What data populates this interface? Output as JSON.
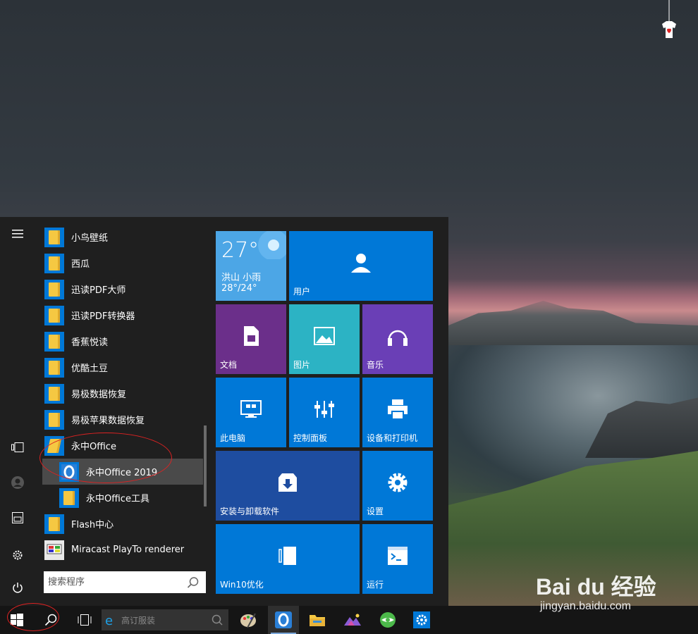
{
  "app_list": [
    {
      "label": "小鸟壁纸",
      "type": "folder"
    },
    {
      "label": "西瓜",
      "type": "folder"
    },
    {
      "label": "迅读PDF大师",
      "type": "folder"
    },
    {
      "label": "迅读PDF转换器",
      "type": "folder"
    },
    {
      "label": "香蕉悦读",
      "type": "folder"
    },
    {
      "label": "优酷土豆",
      "type": "folder"
    },
    {
      "label": "易极数据恢复",
      "type": "folder"
    },
    {
      "label": "易极苹果数据恢复",
      "type": "folder"
    },
    {
      "label": "永中Office",
      "type": "folder-open"
    },
    {
      "label": "永中Office 2019",
      "type": "app"
    },
    {
      "label": "永中Office工具",
      "type": "folder"
    },
    {
      "label": "Flash中心",
      "type": "folder"
    },
    {
      "label": "Miracast PlayTo renderer",
      "type": "app"
    }
  ],
  "search": {
    "placeholder": "搜索程序"
  },
  "tiles": {
    "weather": {
      "temp": "27°",
      "city": "洪山",
      "condition": "小雨",
      "range": "28°/24°"
    },
    "user": "用户",
    "documents": "文档",
    "pictures": "图片",
    "music": "音乐",
    "this_pc": "此电脑",
    "control_panel": "控制面板",
    "devices_printers": "设备和打印机",
    "install_uninstall": "安装与卸载软件",
    "settings": "设置",
    "win10_optimize": "Win10优化",
    "run": "运行"
  },
  "taskbar": {
    "search_text": "高订服装"
  },
  "watermark": {
    "brand": "Bai du 经验",
    "url": "jingyan.baidu.com"
  },
  "colors": {
    "tile_blue": "#0078d7",
    "tile_purple": "#6b2f8a",
    "tile_teal": "#2cb3c4",
    "tile_violet": "#6a3fb6",
    "tile_dark_blue": "#1e4da0",
    "weather_blue": "#4ca6e6",
    "annotation_red": "#dd2222"
  }
}
